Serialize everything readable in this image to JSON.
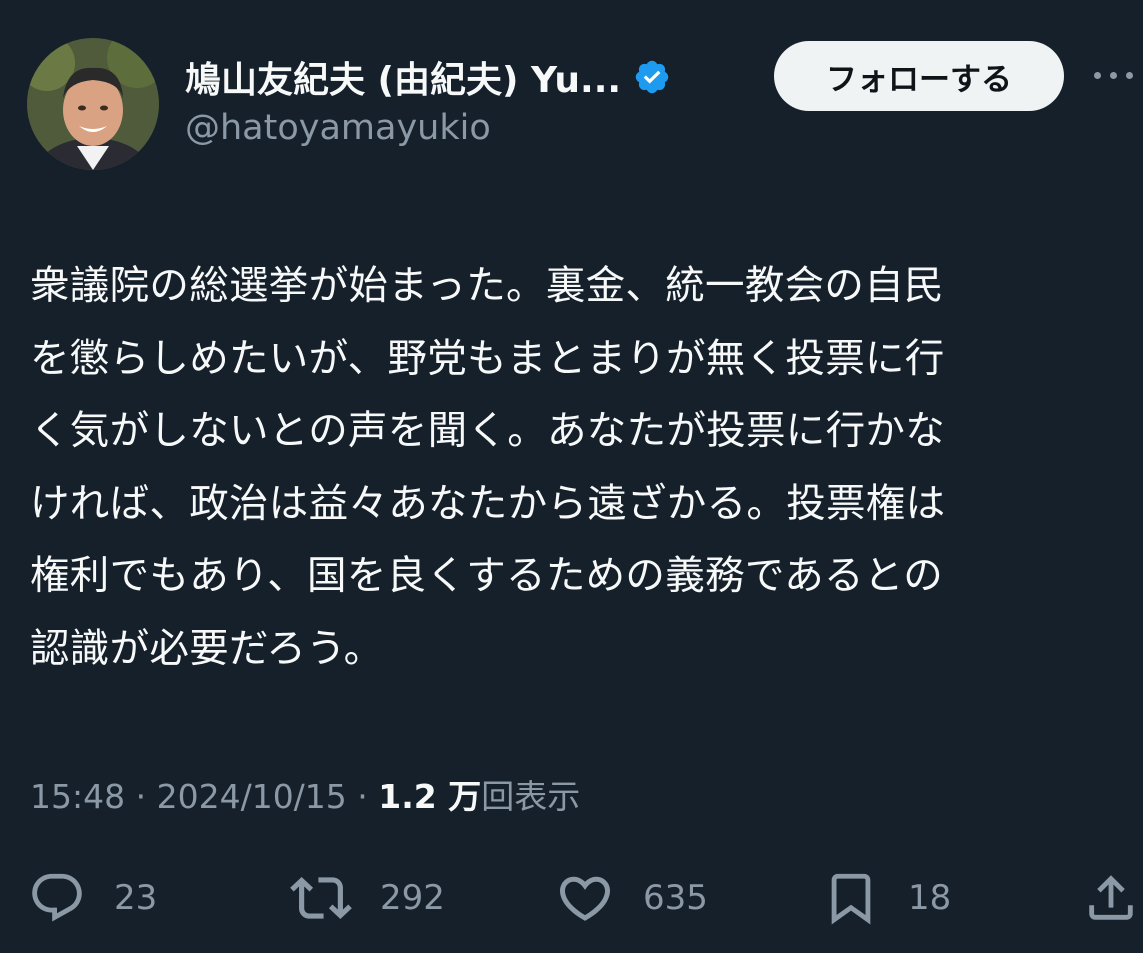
{
  "author": {
    "display_name": "鳩山友紀夫 (由紀夫) Yu...",
    "handle": "@hatoyamayukio",
    "verified_icon": "verified-badge-icon",
    "accent_color": "#1d9bf0"
  },
  "header": {
    "follow_label": "フォローする",
    "more_icon": "more-horizontal-icon"
  },
  "tweet": {
    "lines": [
      "衆議院の総選挙が始まった。裏金、統一教会の自民",
      "を懲らしめたいが、野党もまとまりが無く投票に行",
      "く気がしないとの声を聞く。あなたが投票に行かな",
      "ければ、政治は益々あなたから遠ざかる。投票権は",
      "権利でもあり、国を良くするための義務であるとの",
      "認識が必要だろう。"
    ]
  },
  "meta": {
    "time": "15:48",
    "separator": " · ",
    "date": "2024/10/15",
    "views_count": "1.2 万",
    "views_label": "回表示"
  },
  "actions": {
    "reply": {
      "icon": "reply-icon",
      "count": "23"
    },
    "retweet": {
      "icon": "retweet-icon",
      "count": "292"
    },
    "like": {
      "icon": "heart-icon",
      "count": "635"
    },
    "bookmark": {
      "icon": "bookmark-icon",
      "count": "18"
    },
    "share": {
      "icon": "share-icon"
    }
  },
  "colors": {
    "background": "#15202b",
    "text_primary": "#f7f9f9",
    "text_secondary": "#8b98a5",
    "follow_button_bg": "#eff3f4"
  }
}
